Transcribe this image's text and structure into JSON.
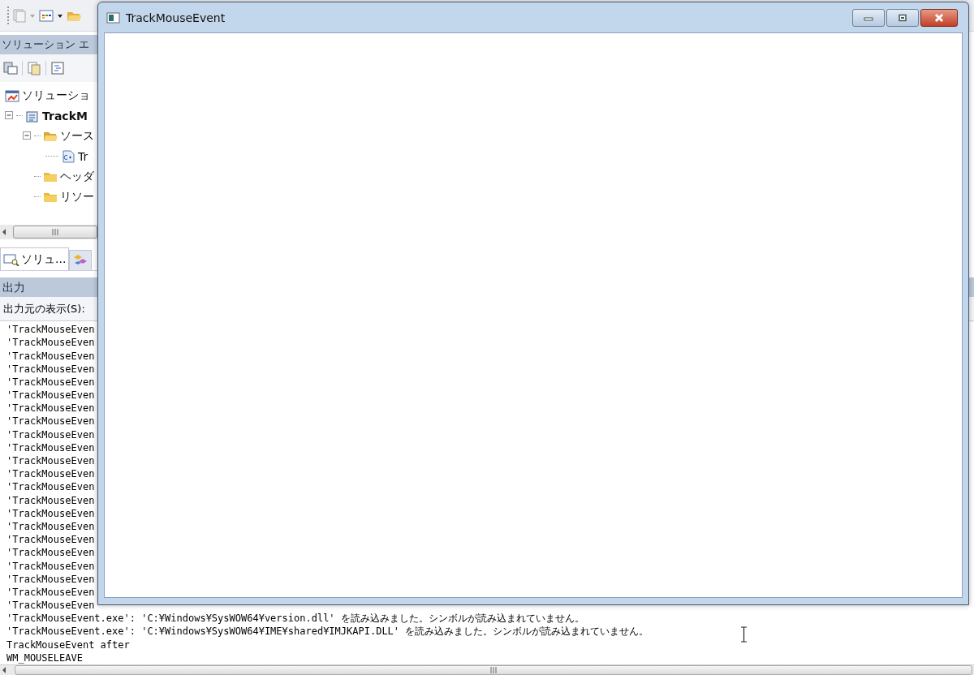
{
  "ide": {
    "solution_panel": {
      "title": "ソリューション エ",
      "tree": [
        {
          "kind": "solution",
          "label": "ソリューショ",
          "children": [
            {
              "kind": "project",
              "label": "TrackM",
              "expanded": true,
              "children": [
                {
                  "kind": "folder-open",
                  "label": "ソース",
                  "expanded": true,
                  "children": [
                    {
                      "kind": "cpp",
                      "label": "Tr"
                    }
                  ]
                },
                {
                  "kind": "folder",
                  "label": "ヘッダ"
                },
                {
                  "kind": "folder",
                  "label": "リソー"
                }
              ]
            }
          ]
        }
      ],
      "tabs": [
        {
          "kind": "solution",
          "label": "ソリュ...",
          "selected": true
        },
        {
          "kind": "class",
          "selected": false
        }
      ]
    },
    "output": {
      "title": "出力",
      "source_label": "出力元の表示(S):",
      "lines": [
        "'TrackMouseEven",
        "'TrackMouseEven",
        "'TrackMouseEven",
        "'TrackMouseEven",
        "'TrackMouseEven",
        "'TrackMouseEven",
        "'TrackMouseEven",
        "'TrackMouseEven",
        "'TrackMouseEven",
        "'TrackMouseEven",
        "'TrackMouseEven",
        "'TrackMouseEven",
        "'TrackMouseEven",
        "'TrackMouseEven",
        "'TrackMouseEven",
        "'TrackMouseEven",
        "'TrackMouseEven",
        "'TrackMouseEven",
        "'TrackMouseEven",
        "'TrackMouseEven",
        "'TrackMouseEven",
        "'TrackMouseEven",
        "'TrackMouseEvent.exe': 'C:¥Windows¥SysWOW64¥version.dll' を読み込みました。シンボルが読み込まれていません。",
        "'TrackMouseEvent.exe': 'C:¥Windows¥SysWOW64¥IME¥shared¥IMJKAPI.DLL' を読み込みました。シンボルが読み込まれていません。",
        "TrackMouseEvent after",
        "WM_MOUSELEAVE"
      ]
    }
  },
  "window": {
    "title": "TrackMouseEvent"
  }
}
